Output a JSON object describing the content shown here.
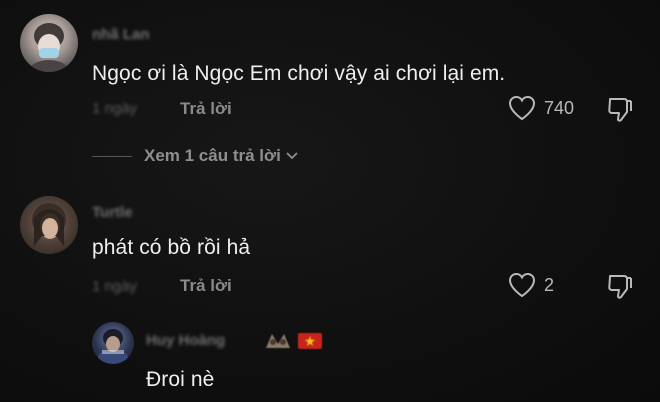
{
  "comments": [
    {
      "username": "nhã Lan",
      "text": "Ngọc ơi là Ngọc Em chơi vậy ai chơi lại em.",
      "time": "1 ngày",
      "reply_label": "Trả lời",
      "like_count": "740"
    },
    {
      "username": "Turtle",
      "text": "phát có bồ rồi hả",
      "time": "1 ngày",
      "reply_label": "Trả lời",
      "like_count": "2"
    }
  ],
  "view_replies_label": "Xem 1 câu trả lời",
  "reply": {
    "username": "Huy Hoàng",
    "text": "Đroi nè"
  },
  "icons": {
    "like": "heart-outline-icon",
    "dislike": "thumbs-down-outline-icon",
    "expand": "chevron-down-icon"
  },
  "colors": {
    "background": "#101010",
    "text": "#efefef",
    "muted": "#8a8a8a"
  }
}
